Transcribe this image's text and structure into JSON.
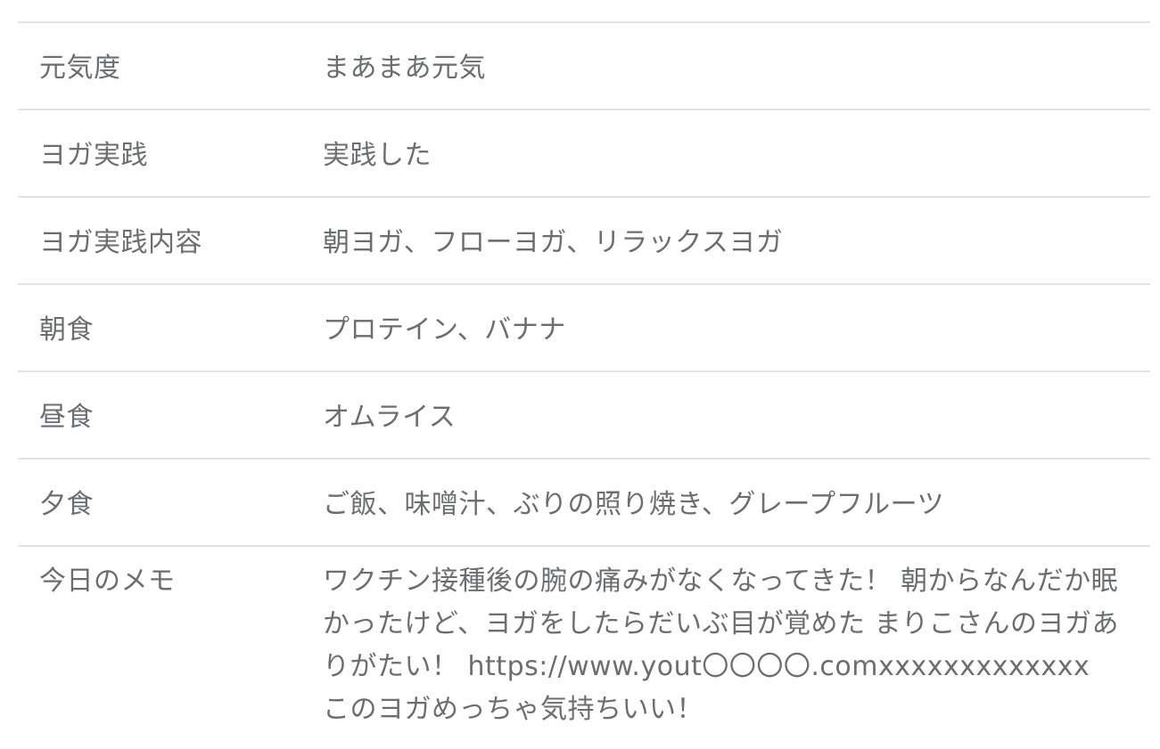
{
  "rows": [
    {
      "label": "元気度",
      "value": "まあまあ元気"
    },
    {
      "label": "ヨガ実践",
      "value": "実践した"
    },
    {
      "label": "ヨガ実践内容",
      "value": "朝ヨガ、フローヨガ、リラックスヨガ"
    },
    {
      "label": "朝食",
      "value": "プロテイン、バナナ"
    },
    {
      "label": "昼食",
      "value": "オムライス"
    },
    {
      "label": "夕食",
      "value": "ご飯、味噌汁、ぶりの照り焼き、グレープフルーツ"
    },
    {
      "label": "今日のメモ",
      "value": "ワクチン接種後の腕の痛みがなくなってきた！ 朝からなんだか眠かったけど、ヨガをしたらだいぶ目が覚めた まりこさんのヨガありがたい！ https://www.yout〇〇〇〇.comxxxxxxxxxxxxx このヨガめっちゃ気持ちいい！"
    }
  ]
}
